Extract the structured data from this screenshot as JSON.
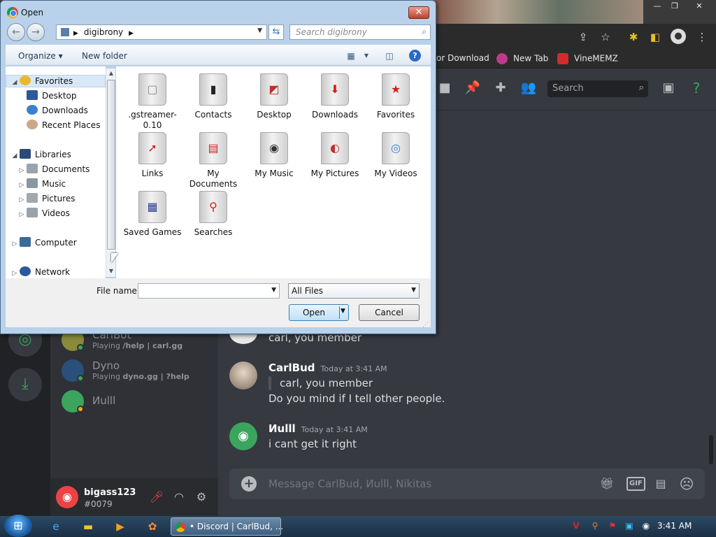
{
  "browser": {
    "bookmarks": [
      {
        "label": "or Download",
        "color": "#f29900"
      },
      {
        "label": "New Tab",
        "color": "#c03a8a"
      },
      {
        "label": "VineMEMZ",
        "color": "#d32b2b"
      }
    ],
    "toolbar_icons": [
      "share-icon",
      "star-icon",
      "extension-icon",
      "sidebar-icon",
      "profile-icon",
      "menu-icon"
    ]
  },
  "discord": {
    "search_placeholder": "Search",
    "members": [
      {
        "name": "CarlBot",
        "activity_prefix": "Playing ",
        "activity": "/help | carl.gg",
        "color": "#8a8a3a"
      },
      {
        "name": "Dyno",
        "activity_prefix": "Playing ",
        "activity": "dyno.gg | ?help",
        "color": "#2a4f7a"
      },
      {
        "name": "Иulll",
        "activity_prefix": "",
        "activity": "",
        "color": "#3ba55d"
      }
    ],
    "user": {
      "name": "bigass123",
      "tag": "#0079"
    },
    "messages": [
      {
        "text": "carl, you member"
      },
      {
        "author": "CarlBud",
        "time": "Today at 3:41 AM",
        "quote": "carl, you member",
        "text": "Do you mind if I tell other people."
      },
      {
        "author": "Иulll",
        "time": "Today at 3:41 AM",
        "text": "i cant get it right"
      }
    ],
    "message_placeholder": "Message CarlBud, Иulll, Nikitas",
    "gif_label": "GIF",
    "accent": "#3ba55d"
  },
  "dialog": {
    "title": "Open",
    "address": "digibrony",
    "search_placeholder": "Search digibrony",
    "organize_label": "Organize ▾",
    "new_folder_label": "New folder",
    "nav": {
      "favorites": "Favorites",
      "desktop": "Desktop",
      "downloads": "Downloads",
      "recent": "Recent Places",
      "libraries": "Libraries",
      "documents": "Documents",
      "music": "Music",
      "pictures": "Pictures",
      "videos": "Videos",
      "computer": "Computer",
      "network": "Network"
    },
    "files": [
      {
        "name": ".gstreamer-0.10",
        "icon": "folder-icon"
      },
      {
        "name": "Contacts",
        "icon": "contacts-folder-icon"
      },
      {
        "name": "Desktop",
        "icon": "desktop-folder-icon"
      },
      {
        "name": "Downloads",
        "icon": "downloads-folder-icon"
      },
      {
        "name": "Favorites",
        "icon": "favorites-folder-icon"
      },
      {
        "name": "Links",
        "icon": "links-folder-icon"
      },
      {
        "name": "My Documents",
        "icon": "documents-folder-icon"
      },
      {
        "name": "My Music",
        "icon": "music-folder-icon"
      },
      {
        "name": "My Pictures",
        "icon": "pictures-folder-icon"
      },
      {
        "name": "My Videos",
        "icon": "videos-folder-icon"
      },
      {
        "name": "Saved Games",
        "icon": "games-folder-icon"
      },
      {
        "name": "Searches",
        "icon": "searches-folder-icon"
      }
    ],
    "file_name_label": "File name:",
    "file_name_value": "",
    "filter_value": "All Files",
    "open_label": "Open",
    "cancel_label": "Cancel"
  },
  "taskbar": {
    "active_window": "• Discord | CarlBud, ...",
    "clock": "3:41 AM"
  }
}
